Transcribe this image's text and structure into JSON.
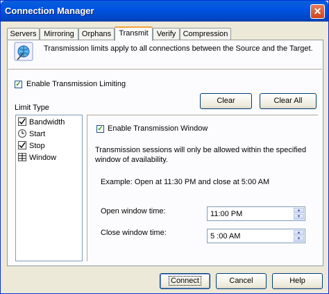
{
  "window": {
    "title": "Connection Manager",
    "close_glyph": "✕"
  },
  "tabs": [
    {
      "label": "Servers"
    },
    {
      "label": "Mirroring"
    },
    {
      "label": "Orphans"
    },
    {
      "label": "Transmit",
      "active": true
    },
    {
      "label": "Verify"
    },
    {
      "label": "Compression"
    }
  ],
  "transmit": {
    "info_text": "Transmission limits apply to all connections between the Source and the Target.",
    "info_icon": "network-globe-icon",
    "enable_limiting_label": "Enable Transmission Limiting",
    "enable_limiting_checked": true,
    "clear_label": "Clear",
    "clear_all_label": "Clear All",
    "limit_type_label": "Limit Type",
    "limit_types": [
      {
        "label": "Bandwidth",
        "icon": "checkbox-icon"
      },
      {
        "label": "Start",
        "icon": "clock-icon"
      },
      {
        "label": "Stop",
        "icon": "checkbox-icon"
      },
      {
        "label": "Window",
        "icon": "window-grid-icon",
        "selected": true
      }
    ],
    "window": {
      "enable_label": "Enable Transmission Window",
      "enable_checked": true,
      "description": "Transmission sessions will only be allowed within the specified window of availability.",
      "example": "Example:  Open at 11:30 PM and close at 5:00 AM",
      "open_label": "Open window time:",
      "open_value": "11:00 PM",
      "close_label": "Close window time:",
      "close_value": "5 :00 AM"
    }
  },
  "footer": {
    "connect_label": "Connect",
    "cancel_label": "Cancel",
    "help_label": "Help"
  },
  "colors": {
    "titlebar": "#0054e3",
    "dialog_bg": "#ece9d8",
    "panel_bg": "#fcfcfe",
    "active_tab_accent": "#f5a23b"
  }
}
